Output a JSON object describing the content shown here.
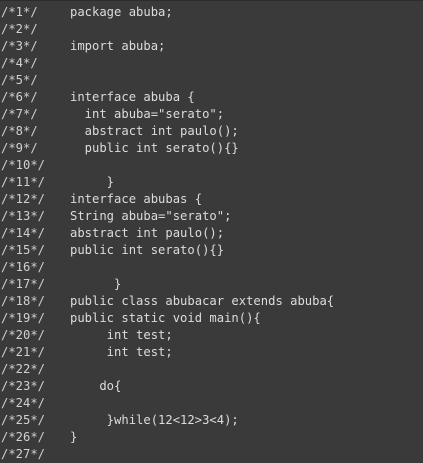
{
  "editor": {
    "lines": [
      {
        "number": "/*1*/",
        "code": "package abuba;"
      },
      {
        "number": "/*2*/",
        "code": ""
      },
      {
        "number": "/*3*/",
        "code": "import abuba;"
      },
      {
        "number": "/*4*/",
        "code": ""
      },
      {
        "number": "/*5*/",
        "code": ""
      },
      {
        "number": "/*6*/",
        "code": "interface abuba {"
      },
      {
        "number": "/*7*/",
        "code": "  int abuba=\"serato\";"
      },
      {
        "number": "/*8*/",
        "code": "  abstract int paulo();"
      },
      {
        "number": "/*9*/",
        "code": "  public int serato(){}"
      },
      {
        "number": "/*10*/",
        "code": ""
      },
      {
        "number": "/*11*/",
        "code": "     }"
      },
      {
        "number": "/*12*/",
        "code": "interface abubas {"
      },
      {
        "number": "/*13*/",
        "code": "String abuba=\"serato\";"
      },
      {
        "number": "/*14*/",
        "code": "abstract int paulo();"
      },
      {
        "number": "/*15*/",
        "code": "public int serato(){}"
      },
      {
        "number": "/*16*/",
        "code": ""
      },
      {
        "number": "/*17*/",
        "code": "      }"
      },
      {
        "number": "/*18*/",
        "code": "public class abubacar extends abuba{"
      },
      {
        "number": "/*19*/",
        "code": "public static void main(){"
      },
      {
        "number": "/*20*/",
        "code": "     int test;"
      },
      {
        "number": "/*21*/",
        "code": "     int test;"
      },
      {
        "number": "/*22*/",
        "code": ""
      },
      {
        "number": "/*23*/",
        "code": "    do{"
      },
      {
        "number": "/*24*/",
        "code": ""
      },
      {
        "number": "/*25*/",
        "code": "     }while(12<12>3<4);"
      },
      {
        "number": "/*26*/",
        "code": "}"
      },
      {
        "number": "/*27*/",
        "code": ""
      }
    ]
  }
}
